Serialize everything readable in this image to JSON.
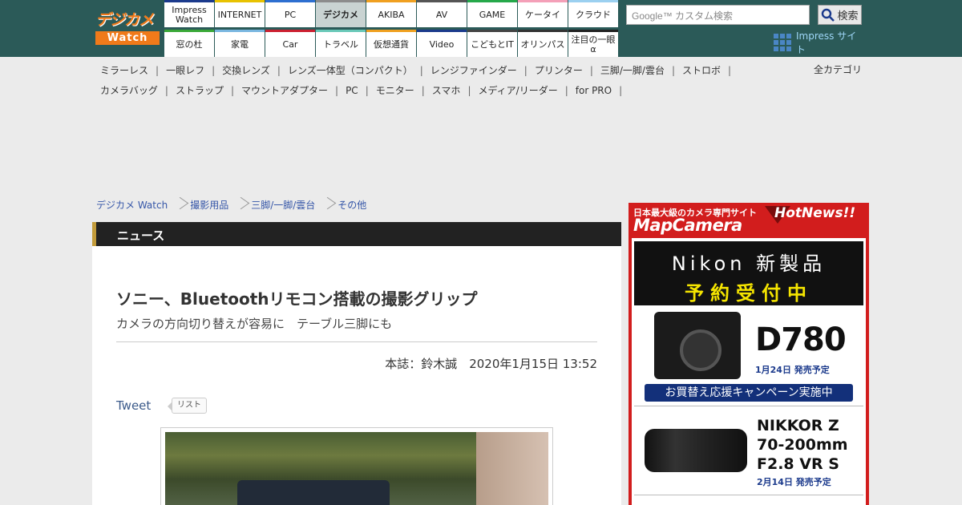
{
  "header": {
    "logo_line1": "デジカメ",
    "logo_line2": "Watch",
    "nav_top": [
      {
        "label": "Impress Watch",
        "color": "#1b3a8c"
      },
      {
        "label": "INTERNET",
        "color": "#e8c200"
      },
      {
        "label": "PC",
        "color": "#2d6fd0"
      },
      {
        "label": "デジカメ",
        "color": "#8c8c8c",
        "selected": true
      },
      {
        "label": "AKIBA",
        "color": "#f0a020"
      },
      {
        "label": "AV",
        "color": "#555555"
      },
      {
        "label": "GAME",
        "color": "#25a84a"
      },
      {
        "label": "ケータイ",
        "color": "#f4a0b8"
      },
      {
        "label": "クラウド",
        "color": "#9bd0f0"
      }
    ],
    "nav_bottom": [
      {
        "label": "窓の杜",
        "color": "#3aa838"
      },
      {
        "label": "家電",
        "color": "#7ab7e0"
      },
      {
        "label": "Car",
        "color": "#cc2030"
      },
      {
        "label": "トラベル",
        "color": "#6ac8b8"
      },
      {
        "label": "仮想通貨",
        "color": "#f0a020"
      },
      {
        "label": "Video",
        "color": "#1b3a8c"
      },
      {
        "label": "こどもとIT",
        "color": "#444444"
      },
      {
        "label": "オリンパス",
        "color": "#333333"
      },
      {
        "label": "注目の一眼α",
        "color": "#222222"
      }
    ],
    "search_placeholder": "Google™ カスタム検索",
    "search_button": "検索",
    "impress_site": "Impress サイト"
  },
  "categories_row1": [
    "ミラーレス",
    "一眼レフ",
    "交換レンズ",
    "レンズ一体型（コンパクト）",
    "レンジファインダー",
    "プリンター",
    "三脚/一脚/雲台",
    "ストロボ"
  ],
  "categories_row2": [
    "カメラバッグ",
    "ストラップ",
    "マウントアダプター",
    "PC",
    "モニター",
    "スマホ",
    "メディア/リーダー",
    "for PRO"
  ],
  "all_categories": "全カテゴリ",
  "breadcrumb": [
    "デジカメ Watch",
    "撮影用品",
    "三脚/一脚/雲台",
    "その他"
  ],
  "section_label": "ニュース",
  "article": {
    "title": "ソニー、Bluetoothリモコン搭載の撮影グリップ",
    "subtitle": "カメラの方向切り替えが容易に　テーブル三脚にも",
    "byline": "本誌：鈴木誠　2020年1月15日 13:52",
    "tweet": "Tweet",
    "list_button": "リスト"
  },
  "ad": {
    "head1": "日本最大級のカメラ専門サイト",
    "head2": "MapCamera",
    "hot": "HotNews!!",
    "black_line1": "Nikon 新製品",
    "black_line2": "予約受付中",
    "product1_name": "D780",
    "product1_date": "1月24日 発売予定",
    "banner": "お買替え応援キャンペーン実施中",
    "product2_line1": "NIKKOR Z",
    "product2_line2": "70-200mm",
    "product2_line3": "F2.8 VR S",
    "product2_date": "2月14日 発売予定"
  }
}
